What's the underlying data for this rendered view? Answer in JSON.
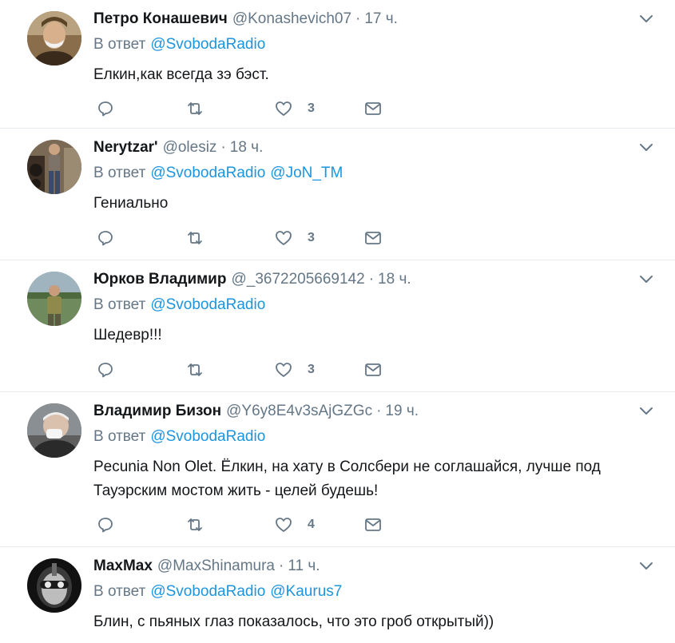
{
  "reply_prefix": "В ответ",
  "tweets": [
    {
      "name": "Петро Конашевич",
      "handle": "@Konashevich07",
      "dot": "·",
      "time": "17 ч.",
      "mentions": [
        "@SvobodaRadio"
      ],
      "text": "Елкин,как всегда зэ бэст.",
      "likes": "3",
      "avatar_icon": "portrait-avatar-icon"
    },
    {
      "name": "Nerytzar'",
      "handle": "@olesiz",
      "dot": "·",
      "time": "18 ч.",
      "mentions": [
        "@SvobodaRadio",
        "@JoN_TM"
      ],
      "text": "Гениально",
      "likes": "3",
      "avatar_icon": "photo-avatar-icon"
    },
    {
      "name": "Юрков Владимир",
      "handle": "@_3672205669142",
      "dot": "·",
      "time": "18 ч.",
      "mentions": [
        "@SvobodaRadio"
      ],
      "text": "Шедевр!!!",
      "likes": "3",
      "avatar_icon": "photo-avatar-icon"
    },
    {
      "name": "Владимир Бизон",
      "handle": "@Y6y8E4v3sAjGZGc",
      "dot": "·",
      "time": "19 ч.",
      "mentions": [
        "@SvobodaRadio"
      ],
      "text": "Pecunia Non Olet. Ёлкин, на хату в Солсбери не соглашайся, лучше под Тауэрским мостом жить - целей будешь!",
      "likes": "4",
      "avatar_icon": "photo-avatar-icon"
    },
    {
      "name": "MaxMax",
      "handle": "@MaxShinamura",
      "dot": "·",
      "time": "11 ч.",
      "mentions": [
        "@SvobodaRadio",
        "@Kaurus7"
      ],
      "text": "Блин, с пьяных глаз показалось, что это гроб открытый))",
      "likes": "",
      "avatar_icon": "photo-avatar-icon"
    }
  ],
  "colors": {
    "link": "#1b95e0",
    "muted": "#657786",
    "text": "#14171a",
    "divider": "#e6ecf0"
  }
}
